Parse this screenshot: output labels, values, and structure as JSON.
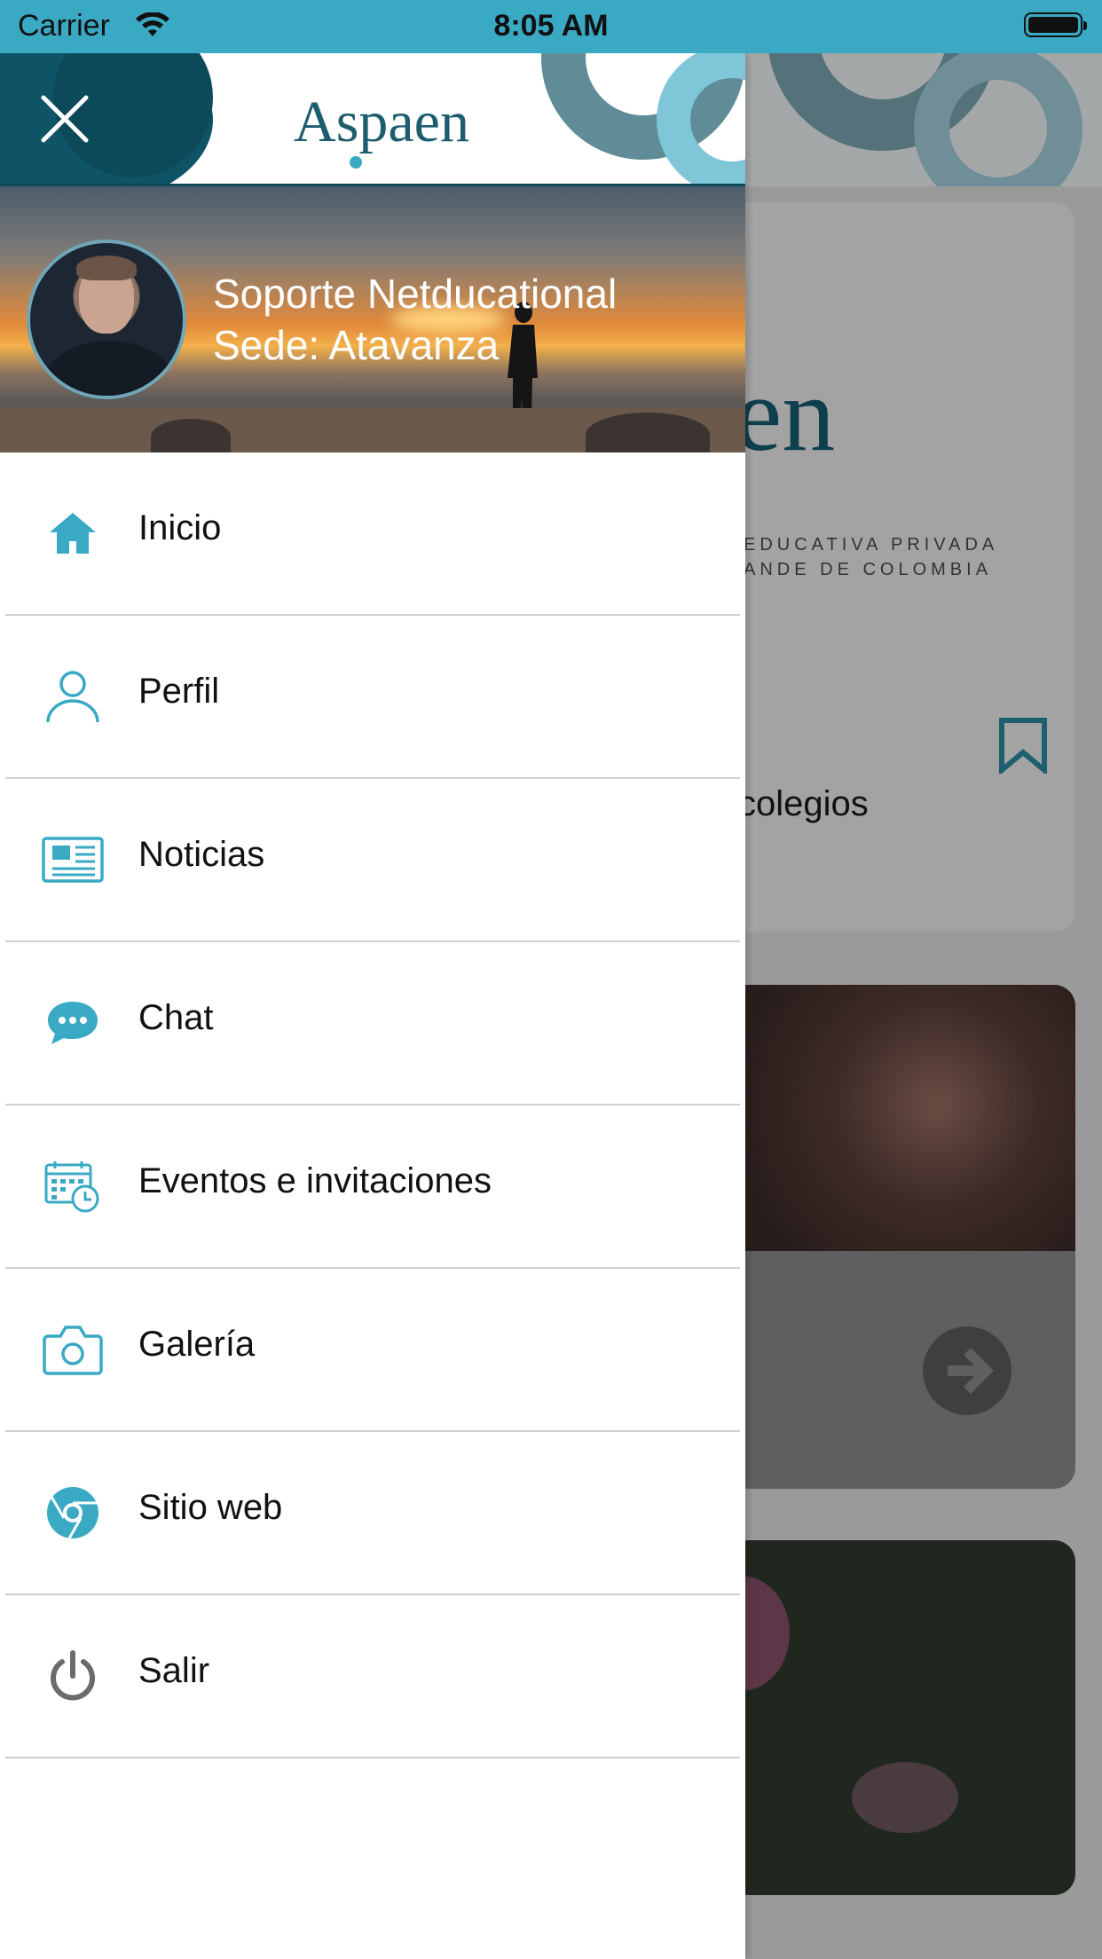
{
  "status_bar": {
    "carrier": "Carrier",
    "time": "8:05 AM"
  },
  "header": {
    "logo_text": "Aspaen"
  },
  "profile": {
    "name": "Soporte Netducational",
    "sede": "Sede: Atavanza"
  },
  "menu": {
    "items": [
      {
        "label": "Inicio",
        "icon": "home-icon"
      },
      {
        "label": "Perfil",
        "icon": "person-icon"
      },
      {
        "label": "Noticias",
        "icon": "newspaper-icon"
      },
      {
        "label": "Chat",
        "icon": "chat-bubble-icon"
      },
      {
        "label": "Eventos e invitaciones",
        "icon": "calendar-clock-icon"
      },
      {
        "label": "Galería",
        "icon": "camera-icon"
      },
      {
        "label": "Sitio web",
        "icon": "browser-icon"
      },
      {
        "label": "Salir",
        "icon": "power-icon"
      }
    ]
  },
  "background": {
    "logo_fragment": "en",
    "tagline_line1": "EDUCATIVA PRIVADA",
    "tagline_line2": "ANDE DE COLOMBIA",
    "card_text": "colegios"
  },
  "colors": {
    "accent": "#3aa9c4",
    "brand_dark": "#0f5466"
  }
}
